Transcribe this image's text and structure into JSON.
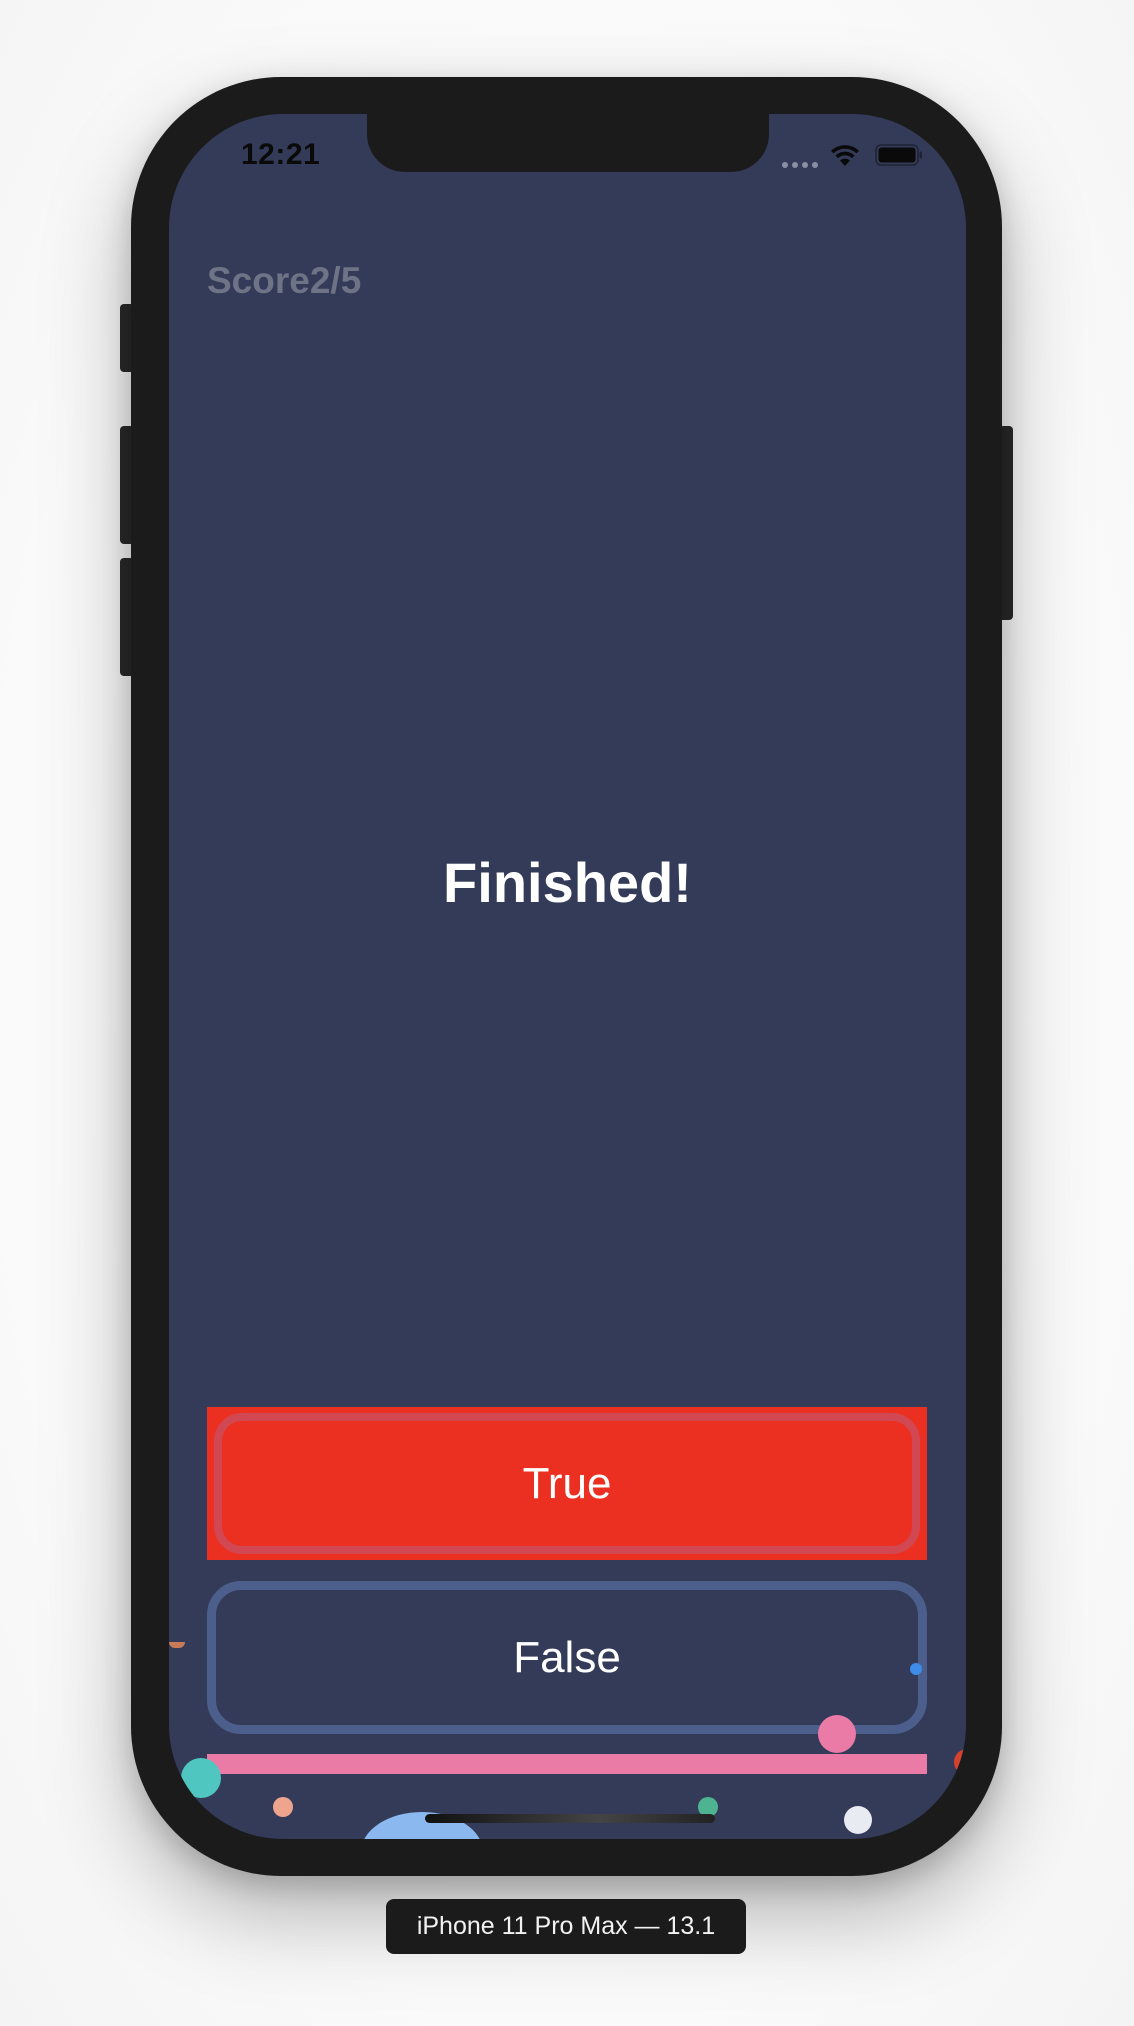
{
  "status_bar": {
    "time": "12:21",
    "wifi_icon": "wifi-icon",
    "battery_icon": "battery-icon"
  },
  "quiz": {
    "score_label": "Score2/5",
    "message": "Finished!",
    "true_label": "True",
    "false_label": "False"
  },
  "device": {
    "caption": "iPhone 11 Pro Max — 13.1"
  },
  "colors": {
    "screen_background": "#333b59",
    "true_button": "#eb3022",
    "false_button_border": "#4c5f8c",
    "progress_bar": "#ea7aa6",
    "score_text": "#6e7385"
  }
}
